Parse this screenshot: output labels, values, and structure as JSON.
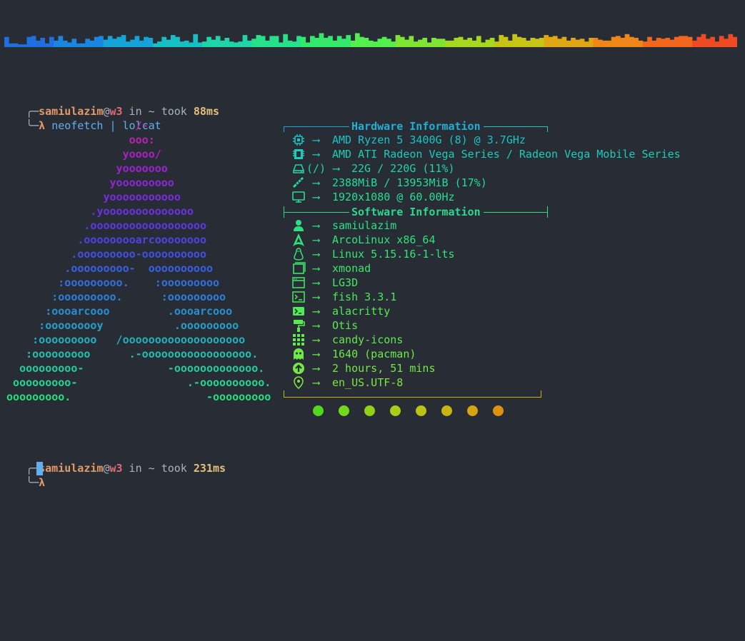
{
  "visualizer": {
    "bar_heights": [
      0.55,
      0.2,
      0.2,
      0.15,
      0.15,
      0.55,
      0.6,
      0.35,
      0.5,
      0.2,
      0.55,
      0.35,
      0.6,
      0.35,
      0.25,
      0.45,
      0.2,
      0.2,
      0.45,
      0.35,
      0.55,
      0.6,
      0.4,
      0.6,
      0.45,
      0.55,
      0.65,
      0.3,
      0.4,
      0.6,
      0.35,
      0.55,
      0.5,
      0.2,
      0.3,
      0.55,
      0.4,
      0.65,
      0.55,
      0.3,
      0.35,
      0.25,
      0.7,
      0.25,
      0.3,
      0.55,
      0.4,
      0.6,
      0.35,
      0.5,
      0.3,
      0.25,
      0.3,
      0.65,
      0.35,
      0.45,
      0.65,
      0.6,
      0.35,
      0.6,
      0.6,
      0.25,
      0.7,
      0.35,
      0.3,
      0.6,
      0.55,
      0.25,
      0.6,
      0.5,
      0.75,
      0.5,
      0.6,
      0.35,
      0.6,
      0.45,
      0.65,
      0.35,
      0.75,
      0.55,
      0.5,
      0.35,
      0.3,
      0.45,
      0.55,
      0.45,
      0.3,
      0.65,
      0.55,
      0.4,
      0.6,
      0.3,
      0.4,
      0.5,
      0.25,
      0.5,
      0.45,
      0.45,
      0.35,
      0.35,
      0.5,
      0.55,
      0.4,
      0.5,
      0.35,
      0.6,
      0.25,
      0.4,
      0.5,
      0.3,
      0.65,
      0.55,
      0.35,
      0.7,
      0.55,
      0.5,
      0.35,
      0.5,
      0.45,
      0.5,
      0.65,
      0.55,
      0.6,
      0.45,
      0.55,
      0.35,
      0.5,
      0.4,
      0.45,
      0.3,
      0.5,
      0.5,
      0.4,
      0.35,
      0.35,
      0.55,
      0.6,
      0.5,
      0.7,
      0.55,
      0.5,
      0.35,
      0.3,
      0.55,
      0.35,
      0.5,
      0.45,
      0.5,
      0.4,
      0.55,
      0.6,
      0.6,
      0.55,
      0.35,
      0.55,
      0.7,
      0.45,
      0.55,
      0.3,
      0.6,
      0.45,
      0.7,
      0.55
    ],
    "colors": [
      "#1f6fe0",
      "#1a86e0",
      "#15a3d8",
      "#17bfc4",
      "#1ed4a8",
      "#26e08a",
      "#34e86c",
      "#52ef4e",
      "#7fe534",
      "#a6d81e",
      "#c7c416",
      "#dfa714",
      "#ee8718",
      "#f3661e",
      "#f04a24"
    ]
  },
  "prompt1": {
    "user": "samiulazim",
    "at": "@",
    "host": "w3",
    "in": " in ",
    "dir": "~",
    "took": " took ",
    "time": "88ms",
    "lambda": "λ",
    "command": "neofetch | lolcat"
  },
  "ascii_art": [
    "                     /-",
    "                    ooo:",
    "                   yoooo/",
    "                  yooooooo",
    "                 yooooooooo",
    "                yooooooooooo",
    "              .yoooooooooooooo",
    "             .oooooooooooooooooo",
    "            .ooooooooarcoooooooo",
    "           .ooooooooo-oooooooooo",
    "          .ooooooooo-  oooooooooo",
    "         :ooooooooo.    :ooooooooo",
    "        :ooooooooo.      :ooooooooo",
    "       :oooarcooo         .oooarcooo",
    "      :ooooooooy           .ooooooooo",
    "     :ooooooooo   /ooooooooooooooooooo",
    "    :ooooooooo      .-ooooooooooooooooo.",
    "   ooooooooo-             -ooooooooooooo.",
    "  ooooooooo-                 .-oooooooooo.",
    " ooooooooo.                     -ooooooooo"
  ],
  "ascii_colors": [
    "#c026a8",
    "#b623b4",
    "#a922c0",
    "#9a24cc",
    "#8a28d4",
    "#7a2cdc",
    "#6a33e0",
    "#5c3ae2",
    "#4e43e4",
    "#4250e4",
    "#3960e2",
    "#3270de",
    "#2c80d8",
    "#2890d0",
    "#25a0c6",
    "#23b0bc",
    "#21bfb0",
    "#21cca0",
    "#22d690",
    "#24de80"
  ],
  "hardware": {
    "header": "Hardware Information",
    "rows": [
      {
        "icon": "cpu-icon",
        "value": "AMD Ryzen 5 3400G (8) @ 3.7GHz",
        "color": "#19c4c4"
      },
      {
        "icon": "gpu-icon",
        "value": "AMD ATI Radeon Vega Series / Radeon Vega Mobile Series",
        "color": "#1ccdb8"
      },
      {
        "icon": "disk-icon",
        "extra": "(/)",
        "value": "22G / 220G (11%)",
        "color": "#20d4aa"
      },
      {
        "icon": "memory-icon",
        "value": "2388MiB / 13953MiB (17%)",
        "color": "#24da9c"
      },
      {
        "icon": "monitor-icon",
        "value": "1920x1080 @ 60.00Hz",
        "color": "#28de90"
      }
    ]
  },
  "software": {
    "header": "Software Information",
    "rows": [
      {
        "icon": "user-icon",
        "value": "samiulazim",
        "color": "#2be084"
      },
      {
        "icon": "arch-icon",
        "value": "ArcoLinux x86_64",
        "color": "#30e27a"
      },
      {
        "icon": "linux-icon",
        "value": "Linux 5.15.16-1-lts",
        "color": "#36e472"
      },
      {
        "icon": "window-icon",
        "value": "xmonad",
        "color": "#3ce66a"
      },
      {
        "icon": "theme-icon",
        "value": "LG3D",
        "color": "#42e864"
      },
      {
        "icon": "terminal-icon",
        "value": "fish 3.3.1",
        "color": "#4ae85c"
      },
      {
        "icon": "terminal-app-icon",
        "value": "alacritty",
        "color": "#52ea56"
      },
      {
        "icon": "paint-roller-icon",
        "value": "Otis",
        "color": "#5aea50"
      },
      {
        "icon": "grid-icon",
        "value": "candy-icons",
        "color": "#62ea4c"
      },
      {
        "icon": "ghost-icon",
        "value": "1640 (pacman)",
        "color": "#6cea48"
      },
      {
        "icon": "uptime-icon",
        "value": "2 hours, 51 mins",
        "color": "#74e844"
      },
      {
        "icon": "location-icon",
        "value": "en_US.UTF-8",
        "color": "#7ce640"
      }
    ]
  },
  "arrow": "⟶",
  "color_dots": [
    "#52d81e",
    "#74d81c",
    "#92d01a",
    "#a8cc18",
    "#bcc216",
    "#cab414",
    "#d4a412",
    "#de9212"
  ],
  "prompt2": {
    "user": "samiulazim",
    "at": "@",
    "host": "w3",
    "in": " in ",
    "dir": "~",
    "took": " took ",
    "time": "231ms",
    "lambda": "λ"
  }
}
